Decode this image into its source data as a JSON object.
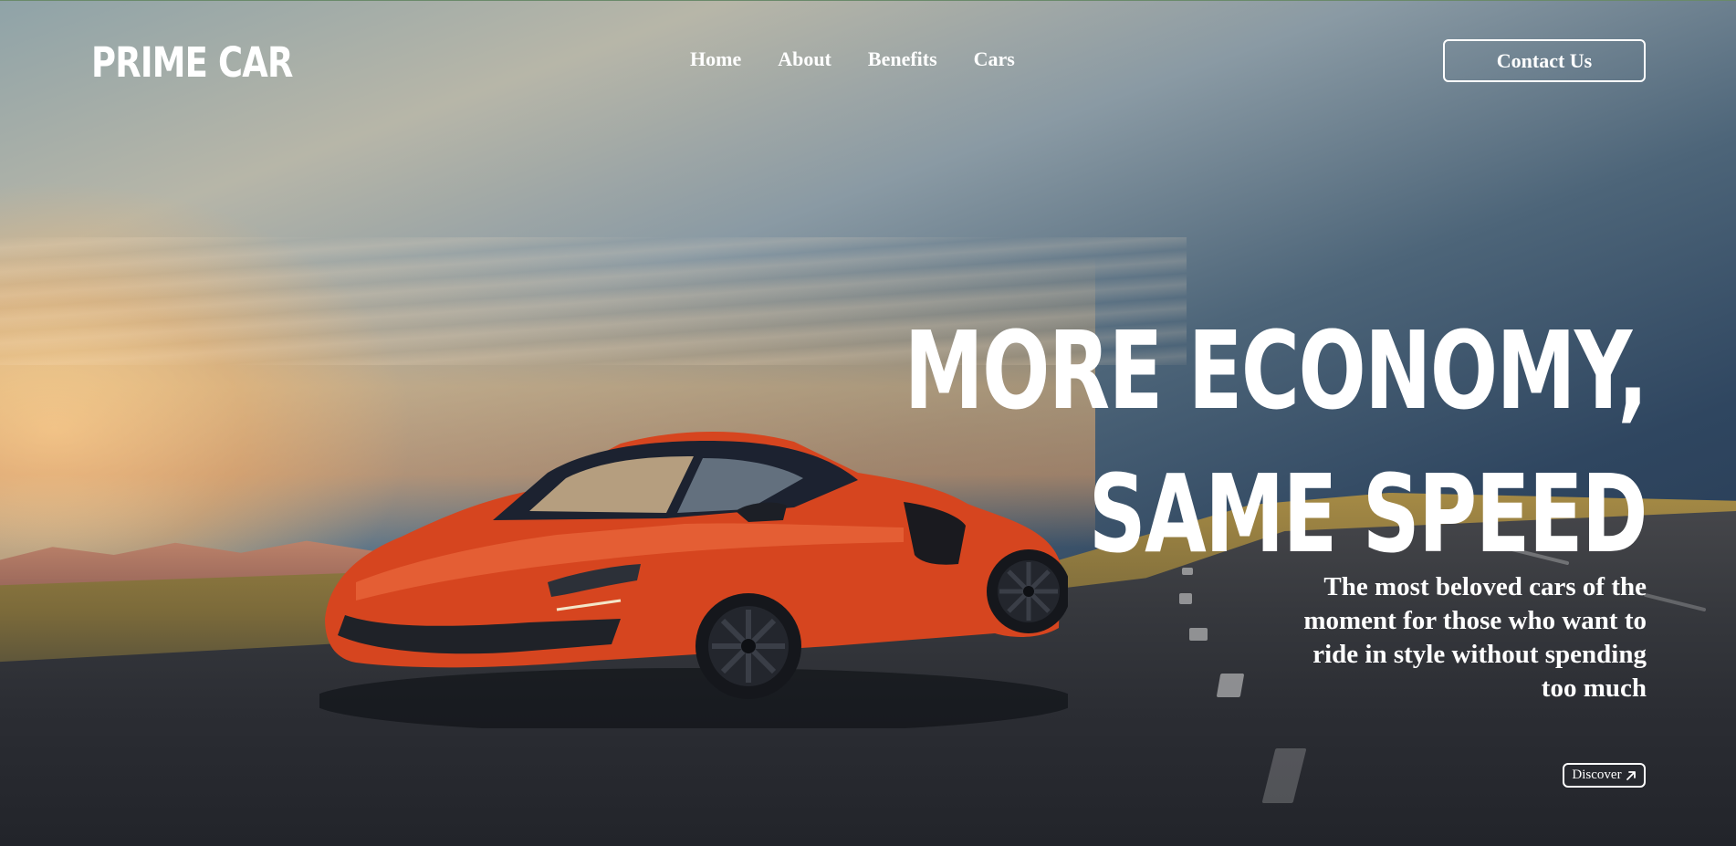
{
  "brand": {
    "logo_text": "PRIME CAR"
  },
  "nav": {
    "items": [
      {
        "label": "Home"
      },
      {
        "label": "About"
      },
      {
        "label": "Benefits"
      },
      {
        "label": "Cars"
      }
    ],
    "contact_label": "Contact Us"
  },
  "hero": {
    "headline_line1": "MORE ECONOMY,",
    "headline_line2": "SAME SPEED",
    "subtext": "The most beloved cars of the moment for those who want to ride in style without spending too much",
    "discover_label": "Discover",
    "discover_icon": "arrow-up-right-icon"
  },
  "colors": {
    "text": "#ffffff",
    "car_body": "#d6451f",
    "sky_warm": "#f0c28a",
    "sky_cool": "#2f4660"
  }
}
